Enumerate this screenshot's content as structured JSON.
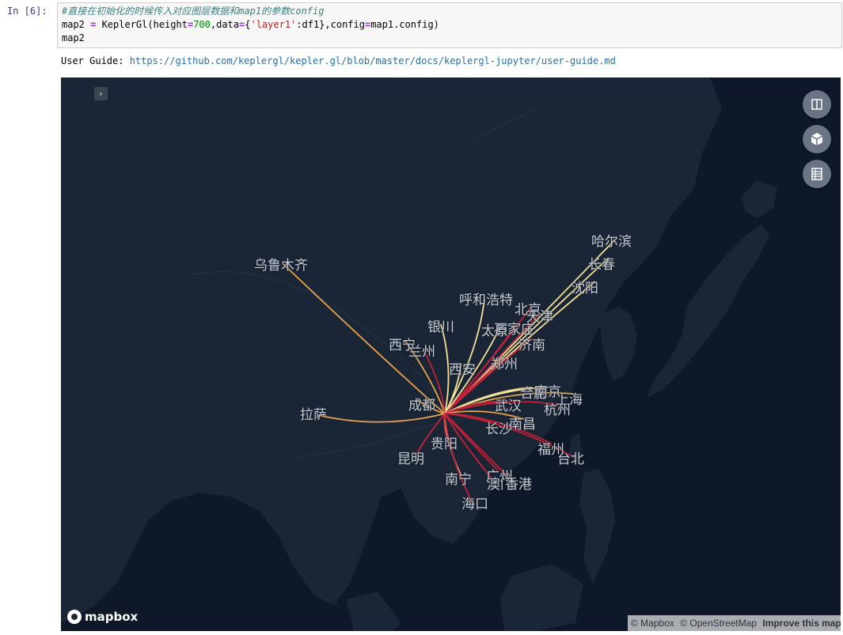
{
  "cell": {
    "prompt": "In  [6]:",
    "code": {
      "comment": "#直接在初始化的时候传入对应图层数据和map1的参数config",
      "line2_a": "map2 ",
      "line2_op1": "=",
      "line2_b": " KeplerGl(height",
      "line2_op2": "=",
      "line2_num": "700",
      "line2_c": ",data",
      "line2_op3": "=",
      "line2_d": "{",
      "line2_str": "'layer1'",
      "line2_e": ":df1},config",
      "line2_op4": "=",
      "line2_f": "map1.config)",
      "line3": "map2"
    }
  },
  "user_guide": {
    "label": "User Guide: ",
    "link": "https://github.com/keplergl/kepler.gl/blob/master/docs/keplergl-jupyter/user-guide.md"
  },
  "map": {
    "sidebar_toggle": "›",
    "controls": [
      "split-map-icon",
      "3d-view-icon",
      "legend-icon"
    ],
    "mapbox_logo": "mapbox",
    "attribution": {
      "mapbox": "© Mapbox",
      "osm": "© OpenStreetMap",
      "improve": "Improve this map"
    },
    "cities": [
      {
        "name": "哈尔滨"
      },
      {
        "name": "长春"
      },
      {
        "name": "沈阳"
      },
      {
        "name": "乌鲁木齐"
      },
      {
        "name": "呼和浩特"
      },
      {
        "name": "北京"
      },
      {
        "name": "天津"
      },
      {
        "name": "石家庄"
      },
      {
        "name": "太原"
      },
      {
        "name": "银川"
      },
      {
        "name": "济南"
      },
      {
        "name": "西宁"
      },
      {
        "name": "兰州"
      },
      {
        "name": "郑州"
      },
      {
        "name": "西安"
      },
      {
        "name": "合肥"
      },
      {
        "name": "南京"
      },
      {
        "name": "上海"
      },
      {
        "name": "成都"
      },
      {
        "name": "武汉"
      },
      {
        "name": "杭州"
      },
      {
        "name": "拉萨"
      },
      {
        "name": "南昌"
      },
      {
        "name": "长沙"
      },
      {
        "name": "贵阳"
      },
      {
        "name": "福州"
      },
      {
        "name": "台北"
      },
      {
        "name": "昆明"
      },
      {
        "name": "南宁"
      },
      {
        "name": "广州"
      },
      {
        "name": "澳门"
      },
      {
        "name": "香港"
      },
      {
        "name": "海口"
      }
    ],
    "colors": {
      "ocean": "#0e1828",
      "land": "#1a2535",
      "arc_light": "#f5e29a",
      "arc_mid": "#e8a44c",
      "arc_dark": "#c0223a"
    }
  }
}
